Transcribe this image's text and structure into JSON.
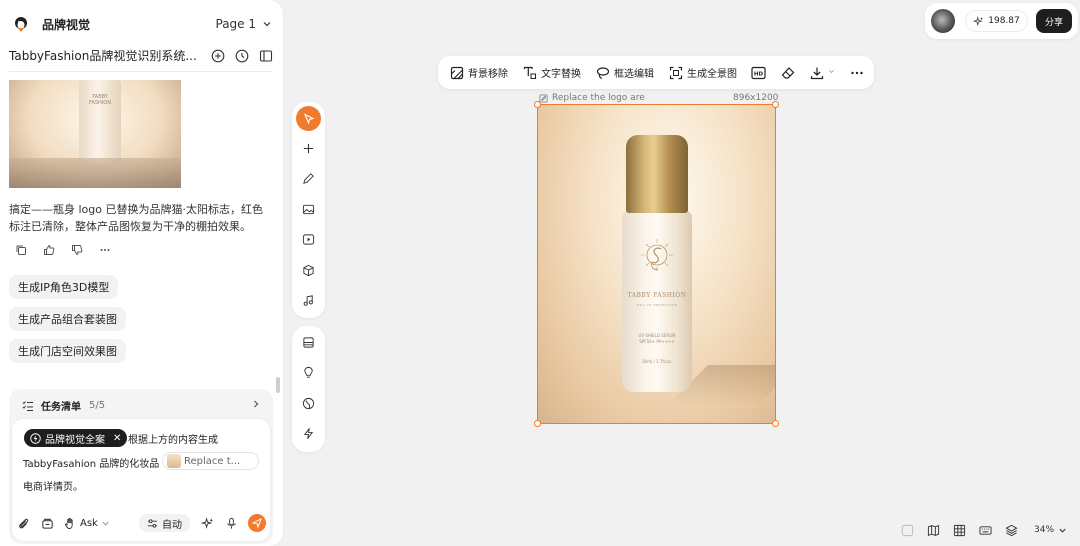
{
  "app": {
    "brand_name": "品牌视觉",
    "page_selector": "Page 1"
  },
  "project": {
    "title": "TabbyFashion品牌视觉识别系统..."
  },
  "chat": {
    "message": "搞定——瓶身 logo 已替换为品牌猫·太阳标志，红色标注已清除，整体产品图恢复为干净的棚拍效果。",
    "suggestions": [
      "生成IP角色3D模型",
      "生成产品组合套装图",
      "生成门店空间效果图"
    ]
  },
  "tasks": {
    "title": "任务清单",
    "count": "5/5"
  },
  "composer": {
    "tag_label": "品牌视觉全案",
    "line1": "根据上方的内容生成",
    "line2": "TabbyFasahion 品牌的化妆品",
    "ref_label": "Replace t...",
    "line3": "电商详情页。",
    "mode_label": "Ask",
    "auto_label": "自动"
  },
  "topbar": {
    "credits": "198.87",
    "share_label": "分享"
  },
  "toolbar": {
    "bg_remove": "背景移除",
    "text_replace": "文字替换",
    "box_edit": "框选编辑",
    "panorama": "生成全景图"
  },
  "canvas_image": {
    "label": "Replace the logo are",
    "size": "896x1200",
    "brand_text": "TABBY FASHION",
    "sub_text": "WILL OF PERFECTION",
    "product_line1": "UV SHIELD SERUM",
    "product_line2": "SPF50+ PA++++",
    "volume": "30ml / 1.7fl.oz."
  },
  "thumb": {
    "brand_text": "TABBY FASHION"
  },
  "zoom": {
    "level": "34%"
  },
  "colors": {
    "accent": "#f07a2d",
    "dark": "#1e1e1e"
  }
}
